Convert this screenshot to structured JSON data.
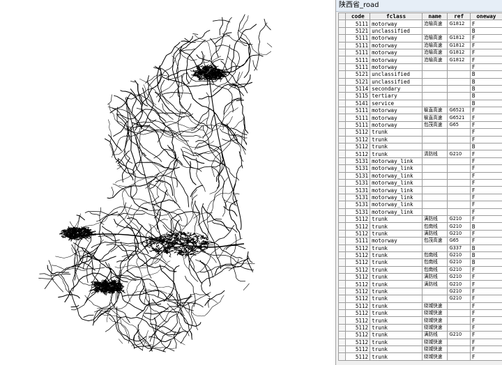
{
  "window": {
    "title": "陕西省_road"
  },
  "map": {
    "line_color": "#000000",
    "background": "#ffffff"
  },
  "table": {
    "columns": [
      "code",
      "fclass",
      "name",
      "ref",
      "oneway"
    ],
    "rows": [
      {
        "code": "5111",
        "fclass": "motorway",
        "name": "沧榆高速",
        "ref": "G1812",
        "oneway": "F"
      },
      {
        "code": "5121",
        "fclass": "unclassified",
        "name": "",
        "ref": "",
        "oneway": "B"
      },
      {
        "code": "5111",
        "fclass": "motorway",
        "name": "沧榆高速",
        "ref": "G1812",
        "oneway": "F"
      },
      {
        "code": "5111",
        "fclass": "motorway",
        "name": "沧榆高速",
        "ref": "G1812",
        "oneway": "F"
      },
      {
        "code": "5111",
        "fclass": "motorway",
        "name": "沧榆高速",
        "ref": "G1812",
        "oneway": "F"
      },
      {
        "code": "5111",
        "fclass": "motorway",
        "name": "沧榆高速",
        "ref": "G1812",
        "oneway": "F"
      },
      {
        "code": "5111",
        "fclass": "motorway",
        "name": "",
        "ref": "",
        "oneway": "F"
      },
      {
        "code": "5121",
        "fclass": "unclassified",
        "name": "",
        "ref": "",
        "oneway": "B"
      },
      {
        "code": "5121",
        "fclass": "unclassified",
        "name": "",
        "ref": "",
        "oneway": "B"
      },
      {
        "code": "5114",
        "fclass": "secondary",
        "name": "",
        "ref": "",
        "oneway": "B"
      },
      {
        "code": "5115",
        "fclass": "tertiary",
        "name": "",
        "ref": "",
        "oneway": "B"
      },
      {
        "code": "5141",
        "fclass": "service",
        "name": "",
        "ref": "",
        "oneway": "B"
      },
      {
        "code": "5111",
        "fclass": "motorway",
        "name": "榆直高速",
        "ref": "G6521",
        "oneway": "F"
      },
      {
        "code": "5111",
        "fclass": "motorway",
        "name": "榆直高速",
        "ref": "G6521",
        "oneway": "F"
      },
      {
        "code": "5111",
        "fclass": "motorway",
        "name": "包茂高速",
        "ref": "G65",
        "oneway": "F"
      },
      {
        "code": "5112",
        "fclass": "trunk",
        "name": "",
        "ref": "",
        "oneway": "F"
      },
      {
        "code": "5112",
        "fclass": "trunk",
        "name": "",
        "ref": "",
        "oneway": "F"
      },
      {
        "code": "5112",
        "fclass": "trunk",
        "name": "",
        "ref": "",
        "oneway": "B"
      },
      {
        "code": "5112",
        "fclass": "trunk",
        "name": "清防线",
        "ref": "G210",
        "oneway": "F"
      },
      {
        "code": "5131",
        "fclass": "motorway_link",
        "name": "",
        "ref": "",
        "oneway": "F"
      },
      {
        "code": "5131",
        "fclass": "motorway_link",
        "name": "",
        "ref": "",
        "oneway": "F"
      },
      {
        "code": "5131",
        "fclass": "motorway_link",
        "name": "",
        "ref": "",
        "oneway": "F"
      },
      {
        "code": "5131",
        "fclass": "motorway_link",
        "name": "",
        "ref": "",
        "oneway": "F"
      },
      {
        "code": "5131",
        "fclass": "motorway_link",
        "name": "",
        "ref": "",
        "oneway": "F"
      },
      {
        "code": "5131",
        "fclass": "motorway_link",
        "name": "",
        "ref": "",
        "oneway": "F"
      },
      {
        "code": "5131",
        "fclass": "motorway_link",
        "name": "",
        "ref": "",
        "oneway": "F"
      },
      {
        "code": "5131",
        "fclass": "motorway_link",
        "name": "",
        "ref": "",
        "oneway": "F"
      },
      {
        "code": "5112",
        "fclass": "trunk",
        "name": "满防线",
        "ref": "G210",
        "oneway": "F"
      },
      {
        "code": "5112",
        "fclass": "trunk",
        "name": "包南线",
        "ref": "G210",
        "oneway": "B"
      },
      {
        "code": "5112",
        "fclass": "trunk",
        "name": "满防线",
        "ref": "G210",
        "oneway": "F"
      },
      {
        "code": "5111",
        "fclass": "motorway",
        "name": "包茂高速",
        "ref": "G65",
        "oneway": "F"
      },
      {
        "code": "5112",
        "fclass": "trunk",
        "name": "",
        "ref": "G337",
        "oneway": "B"
      },
      {
        "code": "5112",
        "fclass": "trunk",
        "name": "包南线",
        "ref": "G210",
        "oneway": "B"
      },
      {
        "code": "5112",
        "fclass": "trunk",
        "name": "包南线",
        "ref": "G210",
        "oneway": "B"
      },
      {
        "code": "5112",
        "fclass": "trunk",
        "name": "包南线",
        "ref": "G210",
        "oneway": "F"
      },
      {
        "code": "5112",
        "fclass": "trunk",
        "name": "满防线",
        "ref": "G210",
        "oneway": "F"
      },
      {
        "code": "5112",
        "fclass": "trunk",
        "name": "满防线",
        "ref": "G210",
        "oneway": "F"
      },
      {
        "code": "5112",
        "fclass": "trunk",
        "name": "",
        "ref": "G210",
        "oneway": "F"
      },
      {
        "code": "5112",
        "fclass": "trunk",
        "name": "",
        "ref": "G210",
        "oneway": "F"
      },
      {
        "code": "5112",
        "fclass": "trunk",
        "name": "绕城快速",
        "ref": "",
        "oneway": "F"
      },
      {
        "code": "5112",
        "fclass": "trunk",
        "name": "绕城快速",
        "ref": "",
        "oneway": "F"
      },
      {
        "code": "5112",
        "fclass": "trunk",
        "name": "绕城快速",
        "ref": "",
        "oneway": "F"
      },
      {
        "code": "5112",
        "fclass": "trunk",
        "name": "绕城快速",
        "ref": "",
        "oneway": "F"
      },
      {
        "code": "5112",
        "fclass": "trunk",
        "name": "满防线",
        "ref": "G210",
        "oneway": "F"
      },
      {
        "code": "5112",
        "fclass": "trunk",
        "name": "绕城快速",
        "ref": "",
        "oneway": "F"
      },
      {
        "code": "5112",
        "fclass": "trunk",
        "name": "绕城快速",
        "ref": "",
        "oneway": "F"
      },
      {
        "code": "5112",
        "fclass": "trunk",
        "name": "绕城快速",
        "ref": "",
        "oneway": "F"
      }
    ]
  }
}
